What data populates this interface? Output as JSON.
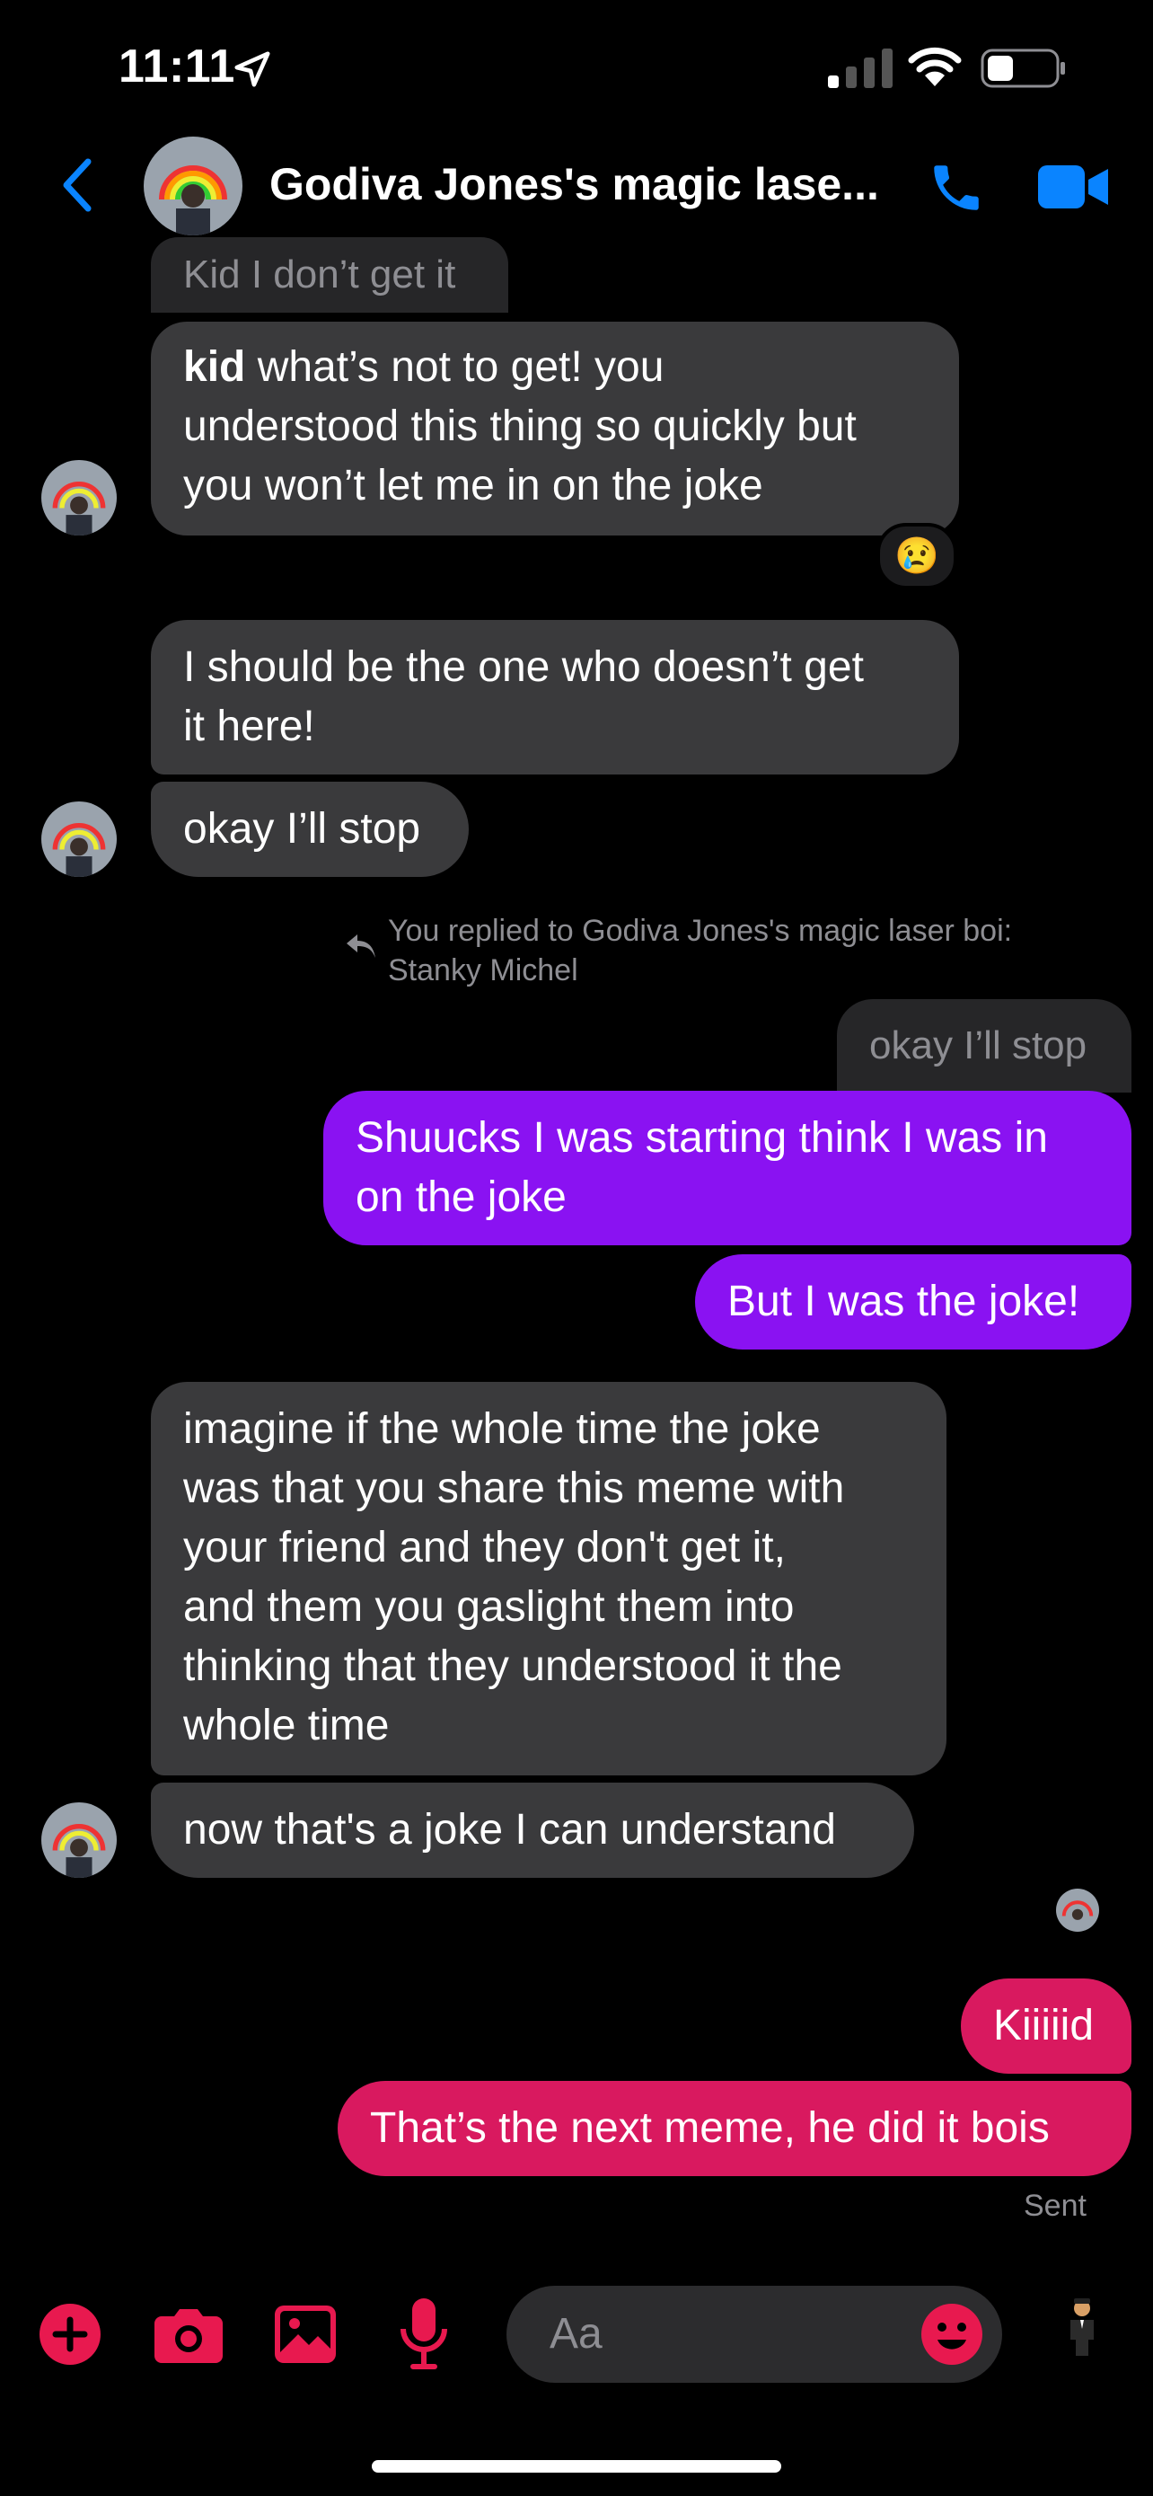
{
  "status_bar": {
    "time": "11:11"
  },
  "header": {
    "title": "Godiva Jones's magic lase..."
  },
  "messages": {
    "m0": "Kid I don’t get it",
    "m1_bold": "kid",
    "m1_l1": " what’s not to get!  you",
    "m1_l2": "understood this thing so quickly but",
    "m1_l3": "you won’t let me in on the joke",
    "m1_reaction": "😢",
    "m2_l1": "I should be the one who doesn’t get",
    "m2_l2": "it here!",
    "m3": "okay I’ll stop",
    "reply_l1": "You replied to Godiva Jones's magic laser boi:",
    "reply_l2": "Stanky Michel",
    "quoted": "okay I’ll stop",
    "m4_l1": "Shuucks I was starting think I was in",
    "m4_l2": "on the joke",
    "m5": "But I was the joke!",
    "m6_l1": "imagine if the whole time the joke",
    "m6_l2": "was that you share this meme with",
    "m6_l3": "your friend and they don't get it,",
    "m6_l4": "and them you gaslight them into",
    "m6_l5": "thinking that they understood it the",
    "m6_l6": "whole time",
    "m7": "now that's a joke I can understand",
    "m8": "Kiiiiid",
    "m9": "That’s the next meme, he did it bois",
    "status": "Sent"
  },
  "composer": {
    "placeholder": "Aa"
  },
  "colors": {
    "accent_blue": "#0a84ff",
    "incoming": "#3a3a3c",
    "outgoing_purple": "#8a12f2",
    "outgoing_pink": "#d9195f",
    "composer_icons": "#e8194f"
  },
  "icons": [
    "location-arrow-icon",
    "signal-icon",
    "wifi-icon",
    "battery-icon",
    "back-chevron-icon",
    "phone-icon",
    "video-icon",
    "reply-arrow-icon",
    "plus-icon",
    "camera-icon",
    "image-icon",
    "microphone-icon",
    "emoji-icon",
    "avatar-emoji-icon"
  ]
}
